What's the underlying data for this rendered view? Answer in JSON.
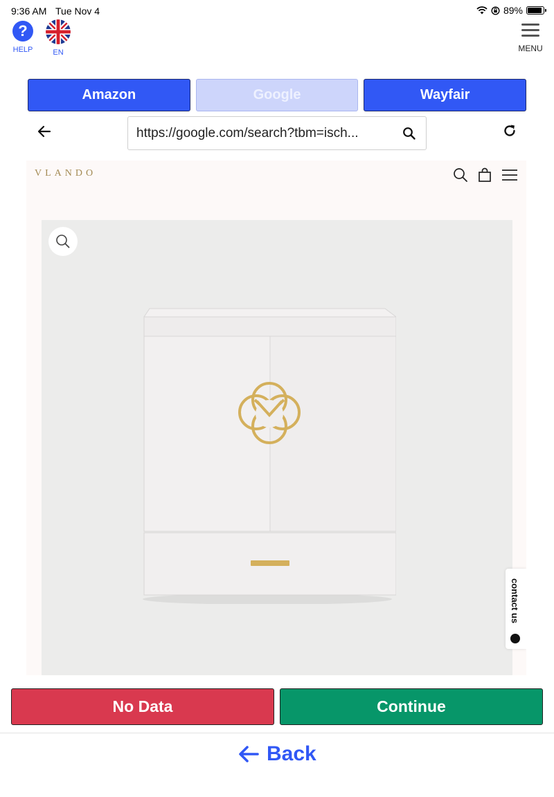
{
  "status_bar": {
    "time": "9:36 AM",
    "date": "Tue Nov 4",
    "battery": "89%",
    "battery_level": 0.89
  },
  "header": {
    "help_label": "HELP",
    "help_glyph": "?",
    "lang_label": "EN",
    "menu_label": "MENU"
  },
  "sources": [
    {
      "label": "Amazon",
      "active": false
    },
    {
      "label": "Google",
      "active": true
    },
    {
      "label": "Wayfair",
      "active": false
    }
  ],
  "browser": {
    "url": "https://google.com/search?tbm=isch..."
  },
  "website": {
    "logo": "VLANDO",
    "contact_label": "contact us"
  },
  "actions": {
    "no_data_label": "No Data",
    "continue_label": "Continue",
    "back_label": "Back"
  },
  "colors": {
    "accent": "#3158f5",
    "no_data": "#d9394f",
    "continue": "#079669",
    "gold": "#d4b05c"
  }
}
